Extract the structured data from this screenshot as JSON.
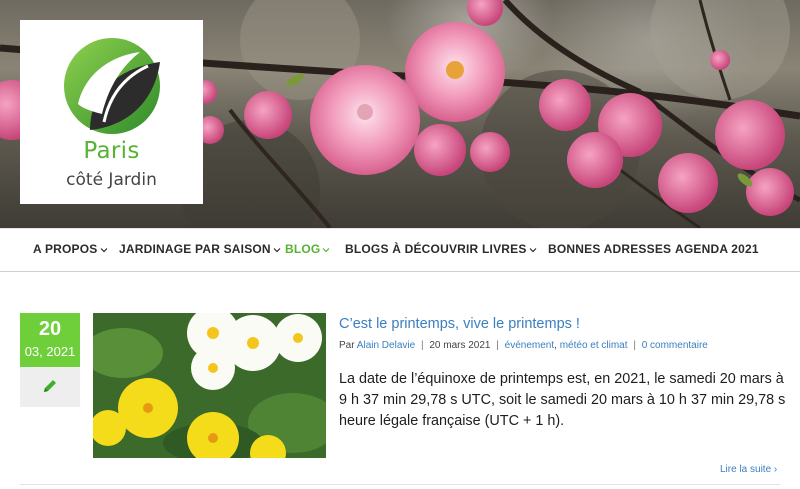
{
  "logo": {
    "line1": "Paris",
    "line2": "côté Jardin"
  },
  "nav": {
    "items": [
      {
        "label": "A PROPOS",
        "has_dropdown": true,
        "active": false
      },
      {
        "label": "JARDINAGE PAR SAISON",
        "has_dropdown": true,
        "active": false
      },
      {
        "label": "BLOG",
        "has_dropdown": true,
        "active": true
      },
      {
        "label": "BLOGS À DÉCOUVRIR",
        "has_dropdown": false,
        "active": false
      },
      {
        "label": "LIVRES",
        "has_dropdown": true,
        "active": false
      },
      {
        "label": "BONNES ADRESSES",
        "has_dropdown": false,
        "active": false
      },
      {
        "label": "AGENDA 2021",
        "has_dropdown": false,
        "active": false
      }
    ]
  },
  "post": {
    "date_day": "20",
    "date_rest": "03, 2021",
    "format_icon": "pencil-icon",
    "title": "C’est le printemps, vive le printemps !",
    "meta": {
      "by": "Par",
      "author": "Alain Delavie",
      "date": "20 mars 2021",
      "category1": "événement",
      "category2": "météo et climat",
      "comments": "0 commentaire"
    },
    "excerpt": "La date de l’équinoxe de printemps est, en 2021, le samedi 20 mars à 9 h 37 min 29,78 s UTC, soit le samedi 20 mars à 10 h 37 min 29,78 s heure légale française (UTC + 1 h).",
    "read_more": "Lire la suite ›"
  },
  "colors": {
    "brand_green": "#58b233",
    "date_green": "#6fcf3a",
    "link_blue": "#3a7fc1"
  }
}
